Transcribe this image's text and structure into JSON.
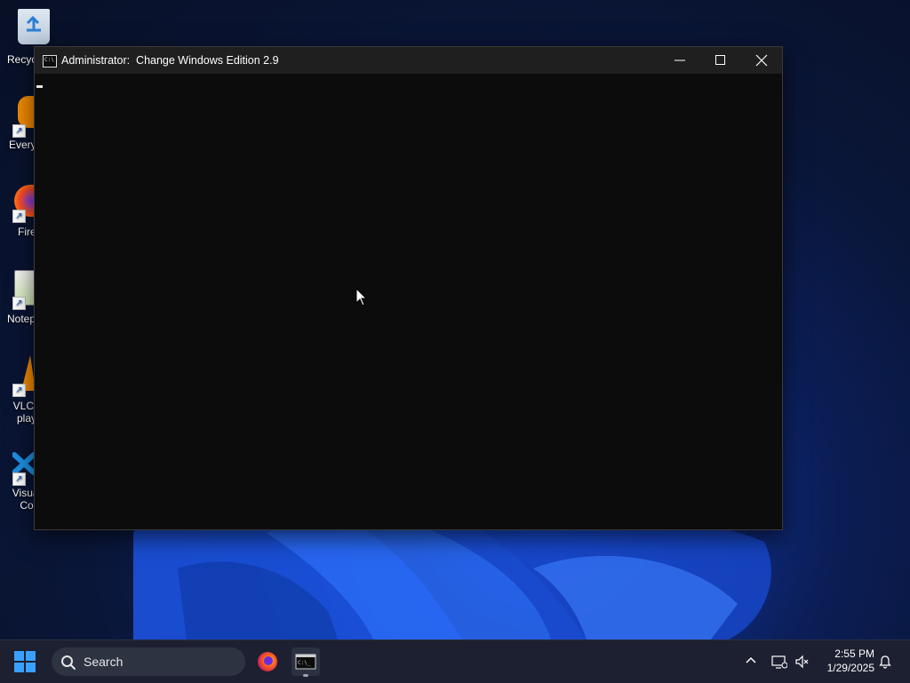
{
  "desktop": {
    "icons": [
      {
        "label": "Recyc",
        "icon": "recycle-bin-icon",
        "color": "#3a8ee6"
      },
      {
        "label": "Every",
        "icon": "everything-search-icon",
        "color": "#f08a00"
      },
      {
        "label": "Fire",
        "icon": "firefox-icon",
        "color": "#ff6a1a"
      },
      {
        "label": "Notep",
        "icon": "notepad-plus-plus-icon",
        "color": "#7bbf3a"
      },
      {
        "label": "VLC r\nplay",
        "icon": "vlc-icon",
        "color": "#f08a00"
      },
      {
        "label": "Visual\nCo",
        "icon": "vscode-icon",
        "color": "#1d8fe0"
      }
    ]
  },
  "window": {
    "title": "Administrator:  Change Windows Edition 2.9",
    "icon": "cmd-icon",
    "minimize_icon": "minimize-icon",
    "maximize_icon": "maximize-icon",
    "close_icon": "close-icon"
  },
  "taskbar": {
    "start_icon": "windows-start-icon",
    "search_placeholder": "Search",
    "apps": [
      {
        "name": "Firefox",
        "icon": "firefox-icon",
        "active": false
      },
      {
        "name": "Command Prompt",
        "icon": "cmd-icon",
        "active": true
      }
    ],
    "tray": {
      "chevron_icon": "chevron-up-icon",
      "network_icon": "network-icon",
      "volume_icon": "volume-muted-icon",
      "notification_icon": "bell-icon"
    },
    "clock": {
      "time": "2:55 PM",
      "date": "1/29/2025"
    }
  },
  "colors": {
    "console_bg": "#0c0c0c",
    "titlebar_bg": "#1f1f1f",
    "taskbar_bg": "#1c2030",
    "accent": "#1a4fd8"
  }
}
